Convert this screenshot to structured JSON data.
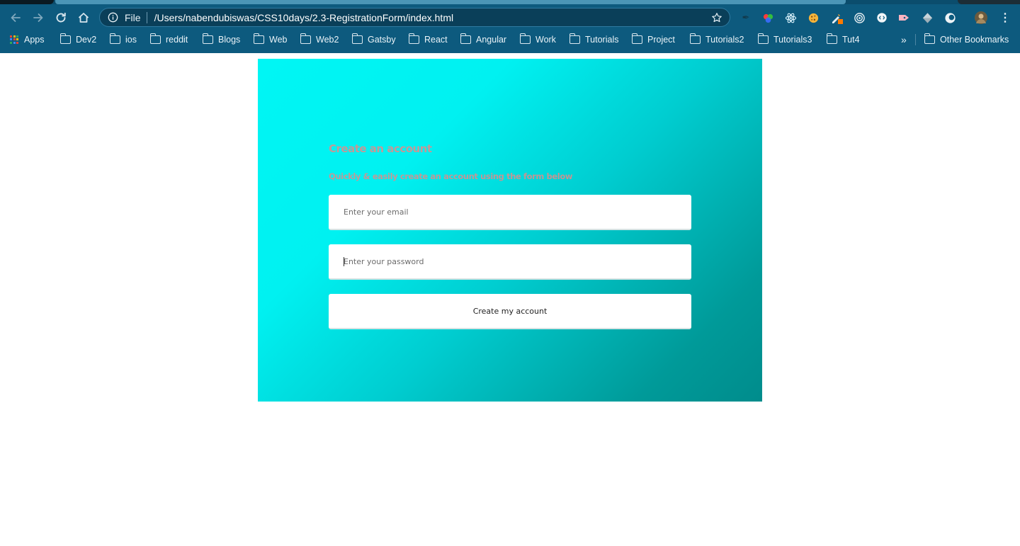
{
  "browser": {
    "scheme": "File",
    "url": "/Users/nabendubiswas/CSS10days/2.3-RegistrationForm/index.html",
    "bookmarks": [
      "Apps",
      "Dev2",
      "ios",
      "reddit",
      "Blogs",
      "Web",
      "Web2",
      "Gatsby",
      "React",
      "Angular",
      "Work",
      "Tutorials",
      "Project",
      "Tutorials2",
      "Tutorials3",
      "Tut4"
    ],
    "overflow": "»",
    "other_bookmarks": "Other Bookmarks",
    "icons": [
      "back-icon",
      "forward-icon",
      "reload-icon",
      "home-icon",
      "info-icon",
      "star-icon",
      "menu-icon"
    ],
    "theme_color": "#0d5a7e"
  },
  "page": {
    "title": "Create an account",
    "subtitle": "Quickly & easily create an account using the form below",
    "email_placeholder": "Enter your email",
    "password_placeholder": "Enter your password",
    "submit_label": "Create my account",
    "gradient_start": "#00f6f4",
    "gradient_end": "#008c8c",
    "heading_color": "#e38b89"
  }
}
